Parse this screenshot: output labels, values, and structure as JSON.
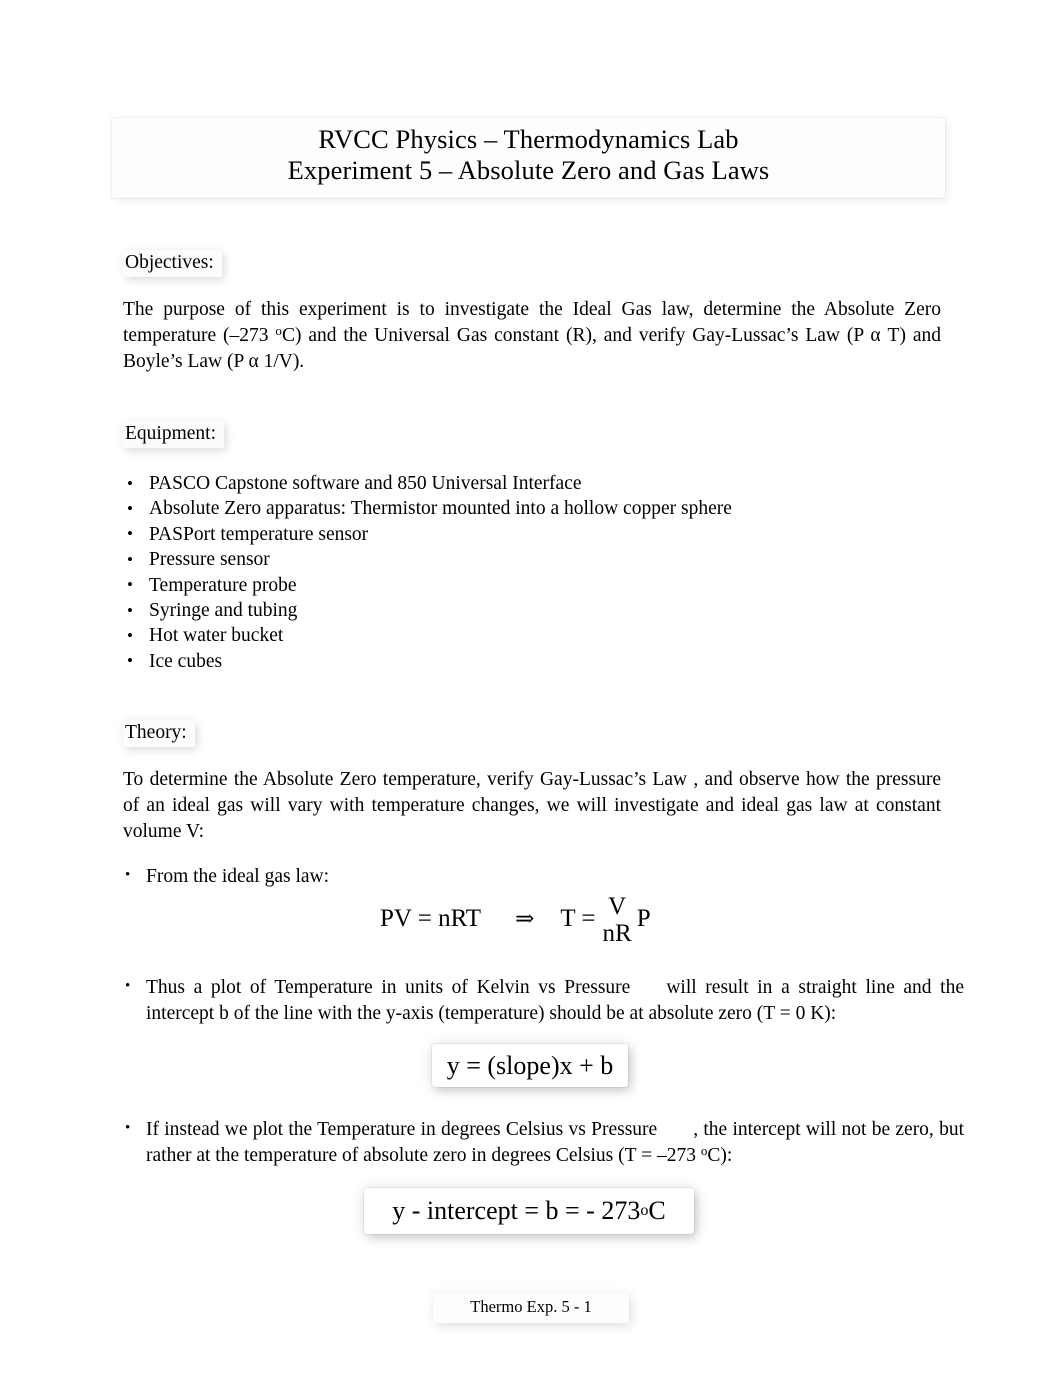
{
  "document": {
    "title_line1": "RVCC Physics – Thermodynamics Lab",
    "title_line2": "Experiment 5 – Absolute Zero and Gas Laws",
    "footer": "Thermo Exp. 5 - 1"
  },
  "objectives": {
    "heading": "Objectives:",
    "body_part1": "The purpose of this experiment is to investigate the Ideal Gas law, determine the Absolute Zero temperature (–273 ",
    "body_degree": "o",
    "body_part2": "C) and the Universal Gas constant (R), and verify Gay-Lussac’s Law (P α T) and Boyle’s Law (P α 1/V)."
  },
  "equipment": {
    "heading": "Equipment:",
    "items": [
      "PASCO Capstone software and 850 Universal Interface",
      "Absolute Zero apparatus: Thermistor mounted into a hollow copper sphere",
      "PASPort temperature sensor",
      "Pressure sensor",
      "Temperature probe",
      "Syringe and tubing",
      "Hot water bucket",
      "Ice cubes"
    ]
  },
  "theory": {
    "heading": "Theory:",
    "intro": "To determine the  Absolute Zero  temperature, verify Gay-Lussac’s Law , and observe how the pressure of an ideal gas will vary with temperature changes, we will investigate and ideal gas law at constant volume V:",
    "bullet1": "From the ideal gas law:",
    "bullet2_part1": "Thus a plot of Temperature in units of Kelvin vs Pressure",
    "bullet2_part2": "will result in a straight line and the intercept b of the line with the y-axis (temperature) should be at absolute zero (T = 0 K):",
    "bullet3_part1": "If instead we plot the Temperature in degrees Celsius vs Pressure",
    "bullet3_part2a": ", the intercept will not be zero, but rather at the temperature of absolute zero in degrees Celsius (T = –273 ",
    "bullet3_degree": "o",
    "bullet3_part2b": "C):"
  },
  "equations": {
    "gas_law": {
      "lhs": "PV = nRT",
      "arrow": "⇒",
      "rhs_lead": "T =",
      "numerator": "V",
      "denominator": "nR",
      "rhs_tail": "P"
    },
    "slope_form": "y = (slope)x + b",
    "y_intercept_part1": "y -  intercept  = b = - 273 ",
    "y_intercept_degree": "o",
    "y_intercept_part2": "C"
  }
}
